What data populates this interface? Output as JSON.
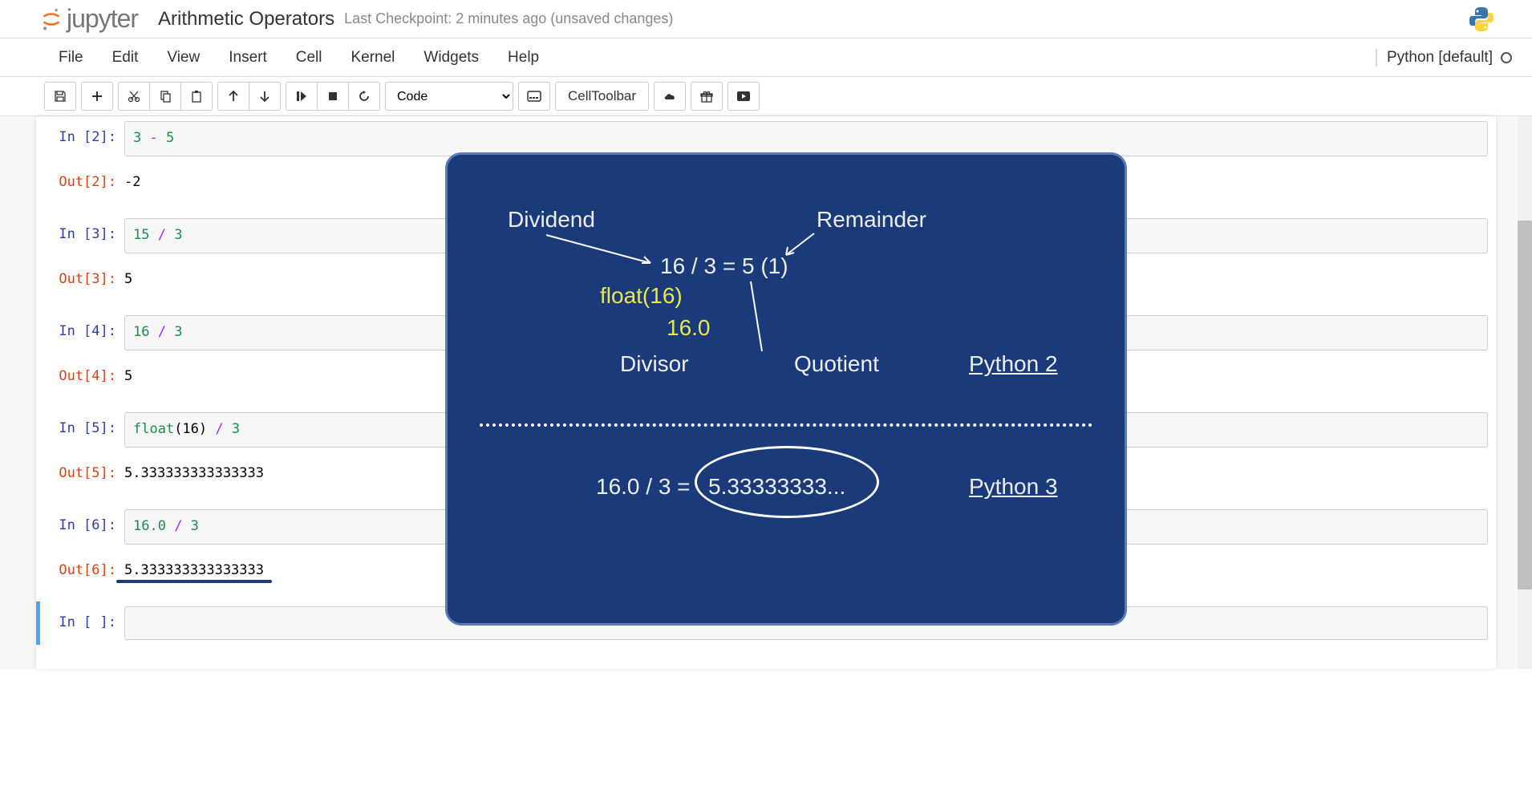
{
  "header": {
    "logo_text": "jupyter",
    "title": "Arithmetic Operators",
    "checkpoint": "Last Checkpoint: 2 minutes ago (unsaved changes)"
  },
  "menu": {
    "file": "File",
    "edit": "Edit",
    "view": "View",
    "insert": "Insert",
    "cell": "Cell",
    "kernel": "Kernel",
    "widgets": "Widgets",
    "help": "Help",
    "kernel_name": "Python [default]"
  },
  "toolbar": {
    "cell_type": "Code",
    "cell_toolbar": "CellToolbar"
  },
  "cells": [
    {
      "in_prompt": "In [2]:",
      "in_code_num1": "3",
      "in_code_op": " - ",
      "in_code_num2": "5",
      "out_prompt": "Out[2]:",
      "out_value": "-2"
    },
    {
      "in_prompt": "In [3]:",
      "in_code_num1": "15",
      "in_code_op": " / ",
      "in_code_num2": "3",
      "out_prompt": "Out[3]:",
      "out_value": "5"
    },
    {
      "in_prompt": "In [4]:",
      "in_code_num1": "16",
      "in_code_op": " / ",
      "in_code_num2": "3",
      "out_prompt": "Out[4]:",
      "out_value": "5"
    },
    {
      "in_prompt": "In [5]:",
      "in_code_builtin": "float",
      "in_code_num1": "(16)",
      "in_code_op": " / ",
      "in_code_num2": "3",
      "out_prompt": "Out[5]:",
      "out_value": "5.333333333333333"
    },
    {
      "in_prompt": "In [6]:",
      "in_code_num1": "16.0",
      "in_code_op": " / ",
      "in_code_num2": "3",
      "out_prompt": "Out[6]:",
      "out_value": "5.333333333333333"
    },
    {
      "in_prompt": "In [ ]:",
      "in_code": ""
    }
  ],
  "overlay": {
    "dividend": "Dividend",
    "remainder": "Remainder",
    "equation1": "16 / 3 = 5 (1)",
    "float_call": "float(16)",
    "float_val": "16.0",
    "divisor": "Divisor",
    "quotient": "Quotient",
    "python2": "Python 2",
    "equation2_left": "16.0 / 3 =",
    "equation2_right": "5.33333333...",
    "python3": "Python 3"
  }
}
